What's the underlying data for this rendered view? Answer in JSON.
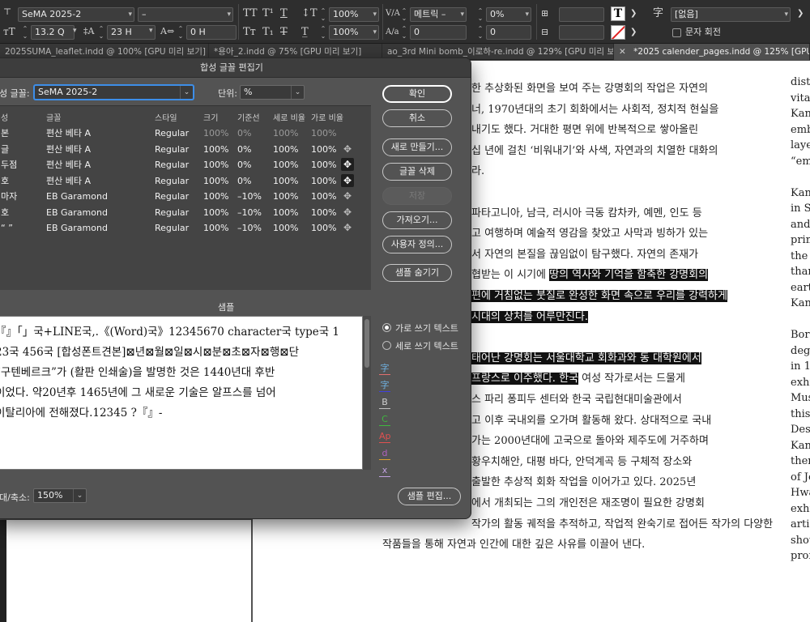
{
  "control_bar": {
    "font_family": "SeMA 2025-2",
    "font_style": "–",
    "font_size": "13.2 Q",
    "leading": "23 H",
    "scale_v": "100%",
    "scale_h": "100%",
    "kerning": "메트릭 –",
    "tracking": "0%",
    "baseline": "0",
    "char_style": "[없음]",
    "char_rotate_label": "문자 회전",
    "tracking2": "0 H",
    "skew": "0",
    "field_right": "0",
    "field_right2": "0",
    "font_glyph": "字"
  },
  "tabs": [
    {
      "label": "2025SUMA_leaflet.indd @ 100% [GPU 미리 보기]",
      "active": false
    },
    {
      "label": "*용아_2.indd @ 75% [GPU 미리 보기]",
      "active": false
    },
    {
      "label": "ao_3rd Mini bomb_이로하-re.indd @ 129% [GPU 미리 보기]",
      "active": false
    },
    {
      "label": "*2025 calender_pages.indd @ 125% [GPU 미리 보기]",
      "active": true
    }
  ],
  "dialog": {
    "title": "합성 글꼴 편집기",
    "font_label": "성 글꼴:",
    "font_value": "SeMA 2025-2",
    "unit_label": "단위:",
    "unit_value": "%",
    "buttons": {
      "ok": "확인",
      "cancel": "취소",
      "new": "새로 만들기...",
      "delete": "글꼴 삭제",
      "save": "저장",
      "import": "가져오기...",
      "custom": "사용자 정의...",
      "hide_sample": "샘플 숨기기",
      "edit_sample": "샘플 편집..."
    },
    "table_headers": [
      "성",
      "글꼴",
      "스타일",
      "크기",
      "기준선",
      "세로 비율",
      "가로 비율"
    ],
    "rows": [
      {
        "set": "본",
        "font": "편산 베타 A",
        "style": "Regular",
        "size": "100%",
        "baseline": "0%",
        "vscale": "100%",
        "hscale": "100%"
      },
      {
        "set": "글",
        "font": "편산 베타 A",
        "style": "Regular",
        "size": "100%",
        "baseline": "0%",
        "vscale": "100%",
        "hscale": "100%"
      },
      {
        "set": "두점",
        "font": "편산 베타 A",
        "style": "Regular",
        "size": "100%",
        "baseline": "0%",
        "vscale": "100%",
        "hscale": "100%"
      },
      {
        "set": "호",
        "font": "편산 베타 A",
        "style": "Regular",
        "size": "100%",
        "baseline": "0%",
        "vscale": "100%",
        "hscale": "100%"
      },
      {
        "set": "마자",
        "font": "EB Garamond",
        "style": "Regular",
        "size": "100%",
        "baseline": "–10%",
        "vscale": "100%",
        "hscale": "100%"
      },
      {
        "set": "호",
        "font": "EB Garamond",
        "style": "Regular",
        "size": "100%",
        "baseline": "–10%",
        "vscale": "100%",
        "hscale": "100%"
      },
      {
        "set": "“ ”",
        "font": "EB Garamond",
        "style": "Regular",
        "size": "100%",
        "baseline": "–10%",
        "vscale": "100%",
        "hscale": "100%"
      }
    ],
    "sample_label": "샘플",
    "sample_lines": [
      "『』「」국+LINE국,.《(Word)국》12345670 character국 type국 1",
      "23국 456국 [합성폰트견본]⊠년⊠월⊠일⊠시⊠분⊠초⊠자⊠행⊠단",
      "“구텐베르크”가 (활판 인쇄술)을 발명한 것은 1440년대 후반",
      "이었다. 약20년후 1465년에 그 새로운 기술은 알프스를 넘어",
      "이탈리아에 전해졌다.12345 ?『』-"
    ],
    "radio_horizontal": "가로 쓰기 텍스트",
    "radio_vertical": "세로 쓰기 텍스트",
    "legend_glyphs": [
      "字",
      "字",
      "B",
      "C",
      "Ap",
      "d",
      "x"
    ],
    "zoom_label": "대/축소:",
    "zoom_value": "150%"
  },
  "document": {
    "lines": [
      {
        "pre": "한 추상화된 화면을 보여 주는 강명회의 작업은 자연의",
        "hl": "",
        "post": ""
      },
      {
        "pre": "너, 1970년대의 초기 회화에서는 사회적, 정치적 현실을",
        "hl": "",
        "post": ""
      },
      {
        "pre": "내기도 했다. 거대한 평면 위에 반복적으로 쌓아올린",
        "hl": "",
        "post": ""
      },
      {
        "pre": "십 년에 걸친 ‘비워내기’와 사색, 자연과의 치열한 대화의",
        "hl": "",
        "post": ""
      },
      {
        "pre": "라.",
        "hl": "",
        "post": ""
      },
      {
        "pre": "",
        "hl": "",
        "post": ""
      },
      {
        "pre": "파타고니아, 남극, 러시아 극동 캄차카, 예멘, 인도 등",
        "hl": "",
        "post": ""
      },
      {
        "pre": "고 여행하며 예술적 영감을 찾았고 사막과 빙하가 있는",
        "hl": "",
        "post": ""
      },
      {
        "pre": "서 자연의 본질을 끊임없이 탐구했다. 자연의 존재가",
        "hl": "",
        "post": ""
      },
      {
        "pre": "협받는 이 시기에 ",
        "hl": "땅의 역사와 기억을 함축한 강명회의",
        "post": ""
      },
      {
        "pre": "",
        "hl": "편에 거침없는 붓질로 완성한 화면 속으로 우리를 강력하게",
        "post": ""
      },
      {
        "pre": "",
        "hl": "시대의 상처를 어루만진다.",
        "post": ""
      },
      {
        "pre": "",
        "hl": "",
        "post": ""
      },
      {
        "pre": "",
        "hl": "태어난 강명회는 서울대학교 회화과와 동 대학원에서",
        "post": ""
      },
      {
        "pre": "",
        "hl": "프랑스로 이주했다. 한국",
        "post": " 여성 작가로서는 드물게"
      },
      {
        "pre": "스 파리 퐁피두 센터와 한국 국립현대미술관에서",
        "hl": "",
        "post": ""
      },
      {
        "pre": "고 이후 국내외를 오가며 활동해 왔다. 상대적으로 국내",
        "hl": "",
        "post": ""
      },
      {
        "pre": "가는 2000년대에 고국으로 돌아와 제주도에 거주하며",
        "hl": "",
        "post": ""
      },
      {
        "pre": "황우치해안, 대평 바다, 안덕계곡 등 구체적 장소와",
        "hl": "",
        "post": ""
      },
      {
        "pre": "출발한 추상적 회화 작업을 이어가고 있다. 2025년",
        "hl": "",
        "post": ""
      },
      {
        "pre": "에서 개최되는 그의 개인전은 재조명이 필요한 강명회",
        "hl": "",
        "post": ""
      },
      {
        "pre": "작가의 활동 궤적을 추적하고, 작업적 완숙기로 접어든 작가의 다양한",
        "hl": "",
        "post": ""
      },
      {
        "pre": "작품들을 통해 자연과 인간에 대한 깊은 사유를 이끌어 낸다.",
        "hl": "",
        "post": ""
      }
    ],
    "right_column": [
      "disti",
      "vital",
      "Kan",
      "emb",
      "layer",
      "“em",
      "",
      "Kan",
      "in Se",
      "and",
      "prim",
      "the c",
      "than",
      "earth",
      "Kan",
      "",
      "Born",
      "degr",
      "in 19",
      "exhi",
      "Mus",
      "this",
      "Desp",
      "Kan",
      "then",
      "of Je",
      "Hwa",
      "exhi",
      "artis",
      "show",
      "prof"
    ]
  }
}
